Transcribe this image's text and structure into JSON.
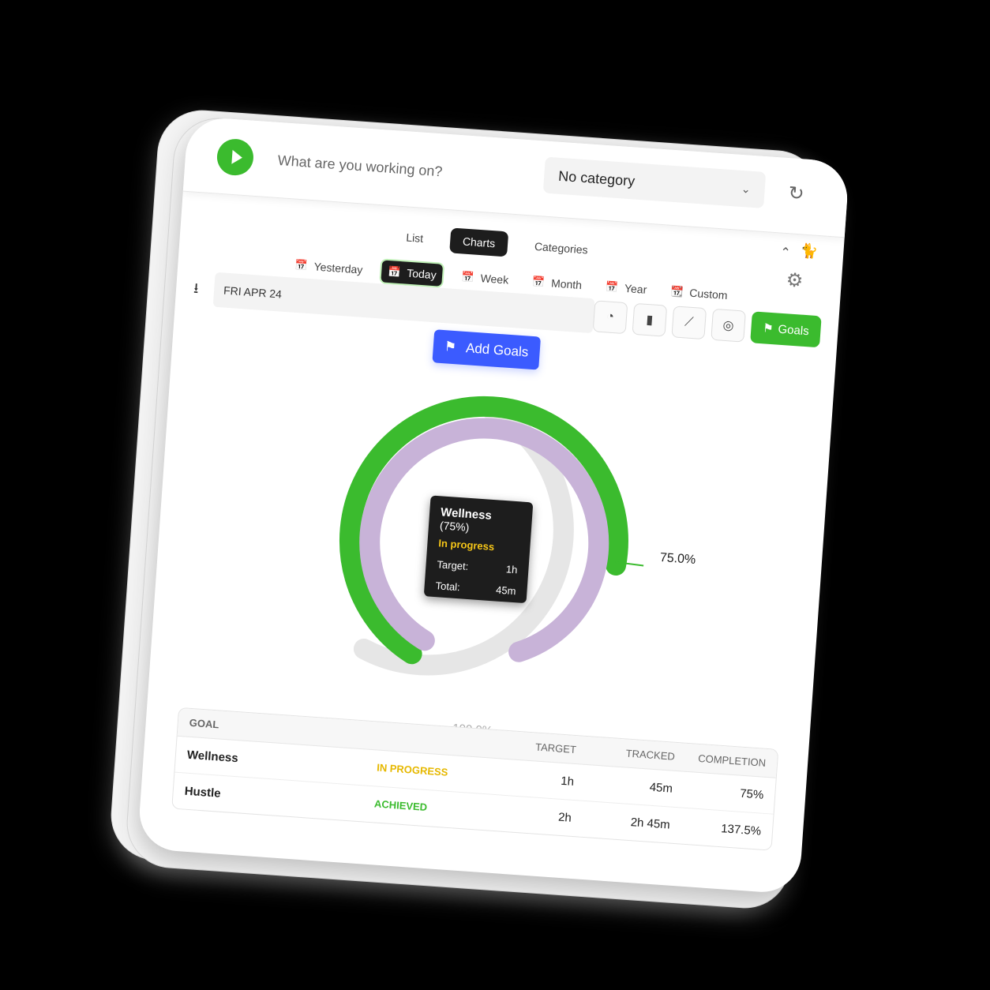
{
  "top": {
    "task_placeholder": "What are you working on?",
    "category_value": "No category"
  },
  "tabs": [
    "List",
    "Charts",
    "Categories"
  ],
  "ranges": [
    "Yesterday",
    "Today",
    "Week",
    "Month",
    "Year",
    "Custom"
  ],
  "date_label": "FRI APR 24",
  "goals_button": "Goals",
  "add_goals_button": "Add Goals",
  "tooltip": {
    "name": "Wellness",
    "pct": "(75%)",
    "status": "In progress",
    "target_label": "Target:",
    "target_value": "1h",
    "total_label": "Total:",
    "total_value": "45m"
  },
  "chart_labels": {
    "partial": "75.0%",
    "full": "100.0%"
  },
  "chart_data": {
    "type": "radial-bar",
    "series": [
      {
        "name": "Wellness",
        "completion": 75.0,
        "color": "#c8b3d8"
      },
      {
        "name": "Hustle",
        "completion": 137.5,
        "color": "#3bbb2e"
      }
    ]
  },
  "table": {
    "headers": [
      "GOAL",
      "",
      "TARGET",
      "TRACKED",
      "COMPLETION"
    ],
    "rows": [
      {
        "goal": "Wellness",
        "status": "IN PROGRESS",
        "target": "1h",
        "tracked": "45m",
        "completion": "75%"
      },
      {
        "goal": "Hustle",
        "status": "ACHIEVED",
        "target": "2h",
        "tracked": "2h 45m",
        "completion": "137.5%"
      }
    ]
  }
}
